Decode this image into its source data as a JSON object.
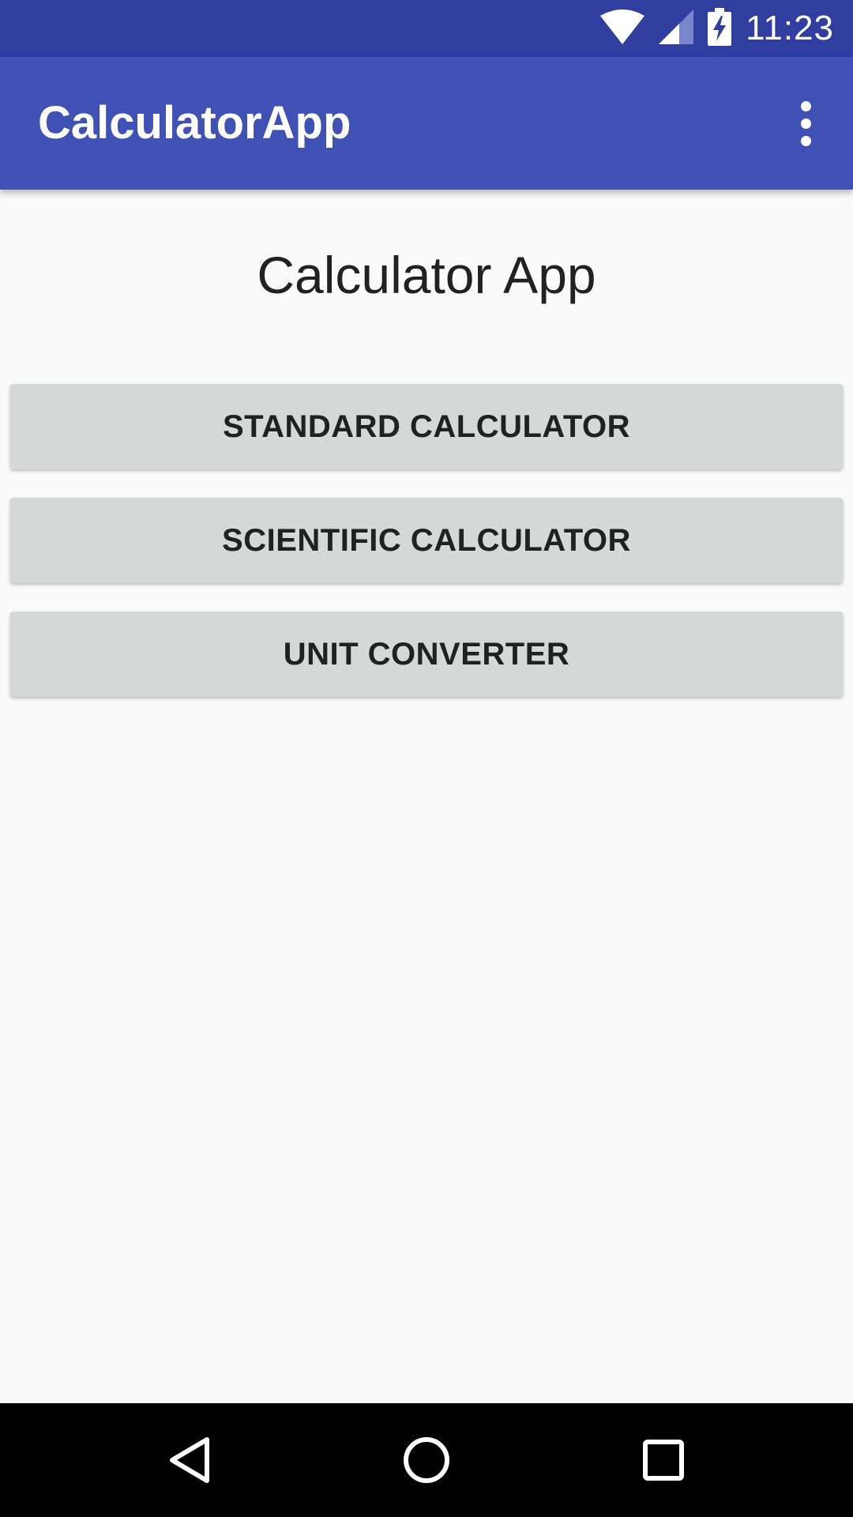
{
  "status_bar": {
    "time": "11:23",
    "icons": [
      "wifi-icon",
      "cellular-signal-icon",
      "battery-charging-icon"
    ]
  },
  "app_bar": {
    "title": "CalculatorApp",
    "overflow_icon": "more-vert-icon"
  },
  "main": {
    "heading": "Calculator App",
    "buttons": [
      {
        "label": "STANDARD CALCULATOR"
      },
      {
        "label": "SCIENTIFIC CALCULATOR"
      },
      {
        "label": "UNIT CONVERTER"
      }
    ]
  },
  "nav_bar": {
    "icons": [
      "back-icon",
      "home-icon",
      "recents-icon"
    ]
  },
  "colors": {
    "status_bar": "#303f9f",
    "app_bar": "#3f51b5",
    "background": "#fafafa",
    "button": "#d6d7d7",
    "nav_bar": "#000000"
  }
}
